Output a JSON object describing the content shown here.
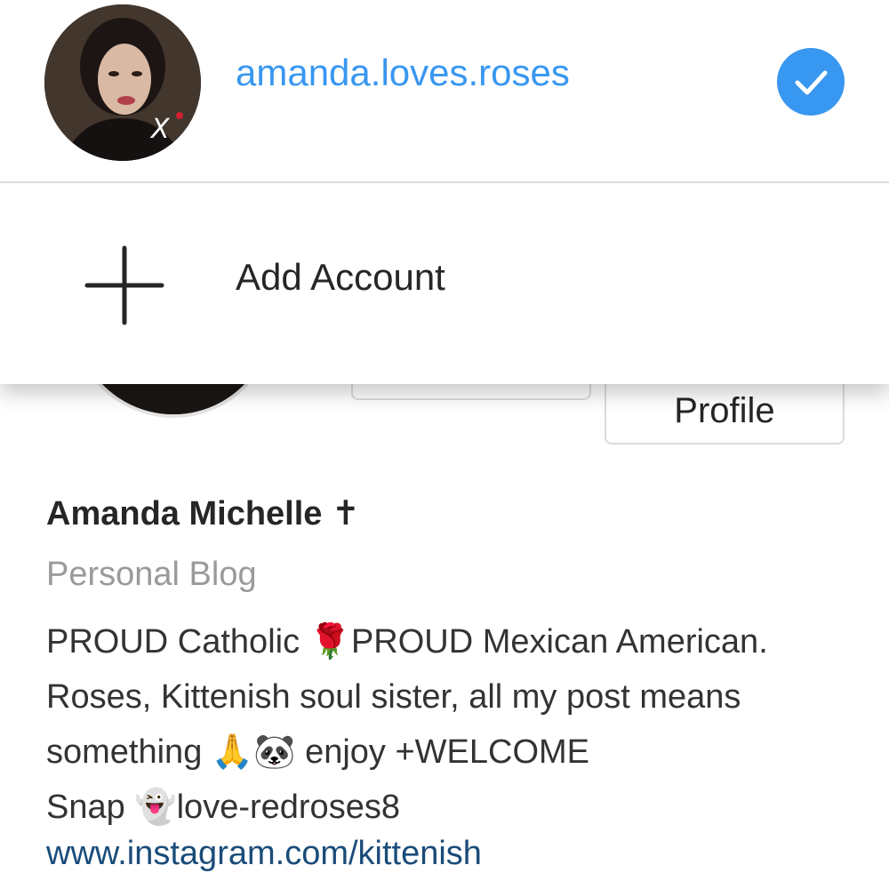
{
  "account_switcher": {
    "current_account": {
      "username": "amanda.loves.roses",
      "avatar_icon": "profile-photo",
      "selected_icon": "check-icon",
      "accent_color": "#3897f0"
    },
    "add_account": {
      "icon": "plus-icon",
      "label": "Add Account"
    }
  },
  "profile": {
    "edit_button_label": "Profile",
    "display_name": "Amanda Michelle ✝",
    "category": "Personal Blog",
    "bio_lines": [
      "PROUD Catholic 🌹PROUD Mexican American.",
      "Roses, Kittenish soul sister, all my post means",
      "something 🙏🐼 enjoy +WELCOME",
      "Snap 👻love-redroses8"
    ],
    "website": "www.instagram.com/kittenish",
    "link_color": "#1a4c79"
  }
}
